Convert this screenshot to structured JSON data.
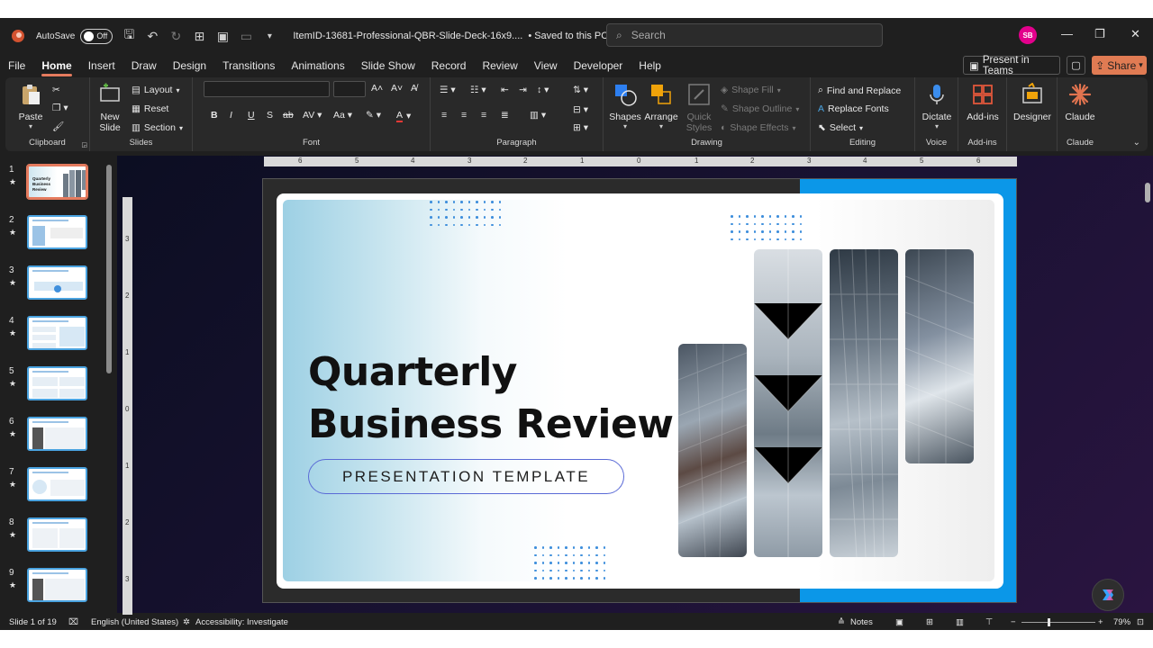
{
  "titlebar": {
    "autosave_label": "AutoSave",
    "autosave_state": "Off",
    "document_name": "ItemID-13681-Professional-QBR-Slide-Deck-16x9....",
    "saved_status": "• Saved to this PC",
    "search_placeholder": "Search",
    "avatar_initials": "SB"
  },
  "menu": {
    "tabs": [
      "File",
      "Home",
      "Insert",
      "Draw",
      "Design",
      "Transitions",
      "Animations",
      "Slide Show",
      "Record",
      "Review",
      "View",
      "Developer",
      "Help"
    ],
    "active_tab": "Home",
    "present_in_teams": "Present in Teams",
    "share": "Share"
  },
  "ribbon": {
    "clipboard": {
      "label": "Clipboard",
      "paste": "Paste"
    },
    "slides": {
      "label": "Slides",
      "new_slide_1": "New",
      "new_slide_2": "Slide",
      "layout": "Layout",
      "reset": "Reset",
      "section": "Section"
    },
    "font": {
      "label": "Font"
    },
    "paragraph": {
      "label": "Paragraph"
    },
    "drawing": {
      "label": "Drawing",
      "shapes": "Shapes",
      "arrange": "Arrange",
      "quick_styles_1": "Quick",
      "quick_styles_2": "Styles",
      "shape_fill": "Shape Fill",
      "shape_outline": "Shape Outline",
      "shape_effects": "Shape Effects"
    },
    "editing": {
      "label": "Editing",
      "find_replace": "Find and Replace",
      "replace_fonts": "Replace Fonts",
      "select": "Select"
    },
    "voice": {
      "label": "Voice",
      "dictate": "Dictate"
    },
    "addins": {
      "label": "Add-ins",
      "addins_btn": "Add-ins"
    },
    "designer": {
      "label": "Designer"
    },
    "claude": {
      "label": "Claude",
      "claude_btn": "Claude"
    }
  },
  "thumbnails": [
    {
      "num": "1",
      "star": "★",
      "selected": true
    },
    {
      "num": "2",
      "star": "★"
    },
    {
      "num": "3",
      "star": "★"
    },
    {
      "num": "4",
      "star": "★"
    },
    {
      "num": "5",
      "star": "★"
    },
    {
      "num": "6",
      "star": "★"
    },
    {
      "num": "7",
      "star": "★"
    },
    {
      "num": "8",
      "star": "★"
    },
    {
      "num": "9",
      "star": "★"
    }
  ],
  "ruler": {
    "horizontal": [
      "6",
      "5",
      "4",
      "3",
      "2",
      "1",
      "0",
      "1",
      "2",
      "3",
      "4",
      "5",
      "6"
    ],
    "vertical": [
      "3",
      "2",
      "1",
      "0",
      "1",
      "2",
      "3"
    ]
  },
  "slide": {
    "title_line1": "Quarterly",
    "title_line2": "Business Review",
    "subtitle": "PRESENTATION TEMPLATE",
    "thumb_title": "Quarterly Business Review"
  },
  "statusbar": {
    "slide_count": "Slide 1 of 19",
    "language": "English (United States)",
    "accessibility": "Accessibility: Investigate",
    "notes": "Notes",
    "zoom": "79%"
  },
  "colors": {
    "accent": "#e57b5e",
    "share": "#e07b53",
    "slide_blue": "#0b97e8",
    "thumb_border": "#4aa3e0"
  }
}
